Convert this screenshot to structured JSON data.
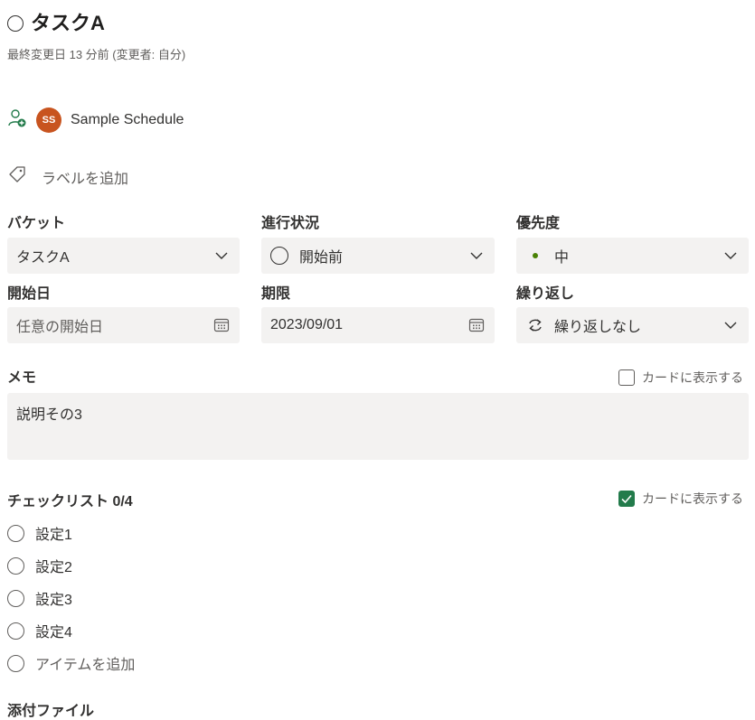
{
  "task": {
    "title": "タスクA",
    "modified": "最終変更日 13 分前 (変更者: 自分)"
  },
  "assignee": {
    "initials": "SS",
    "name": "Sample Schedule",
    "avatar_color": "#c8541f"
  },
  "labels": {
    "add_label": "ラベルを追加"
  },
  "fields": {
    "bucket": {
      "label": "バケット",
      "value": "タスクA"
    },
    "progress": {
      "label": "進行状況",
      "value": "開始前"
    },
    "priority": {
      "label": "優先度",
      "value": "中",
      "dot_color": "#498205"
    },
    "start": {
      "label": "開始日",
      "placeholder": "任意の開始日"
    },
    "due": {
      "label": "期限",
      "value": "2023/09/01"
    },
    "repeat": {
      "label": "繰り返し",
      "value": "繰り返しなし"
    }
  },
  "memo": {
    "label": "メモ",
    "show_on_card": "カードに表示する",
    "show_on_card_checked": false,
    "text": "説明その3"
  },
  "checklist": {
    "label": "チェックリスト 0/4",
    "show_on_card": "カードに表示する",
    "show_on_card_checked": true,
    "items": [
      "設定1",
      "設定2",
      "設定3",
      "設定4"
    ],
    "add_item": "アイテムを追加"
  },
  "attachments": {
    "label": "添付ファイル"
  },
  "colors": {
    "accent_green": "#237b4b",
    "field_bg": "#f3f2f1"
  }
}
